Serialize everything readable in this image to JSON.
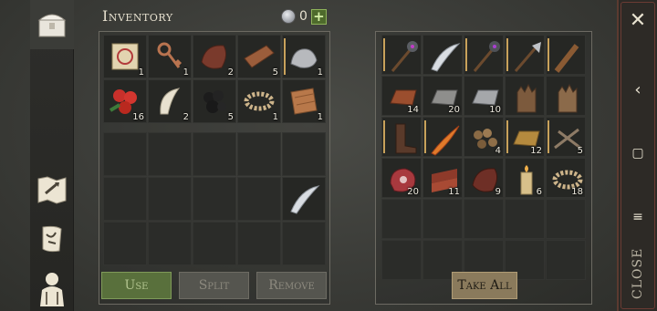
{
  "header": {
    "title": "Inventory",
    "coin_count": "0",
    "add_label": "+"
  },
  "player_items": [
    {
      "icon": "map-scroll-icon",
      "qty": "1"
    },
    {
      "icon": "key-icon",
      "qty": "1"
    },
    {
      "icon": "leather-icon",
      "qty": "2"
    },
    {
      "icon": "cloth-roll-icon",
      "qty": "5"
    },
    {
      "icon": "iron-ore-icon",
      "qty": "1"
    },
    {
      "icon": "berries-icon",
      "qty": "16"
    },
    {
      "icon": "fang-icon",
      "qty": "2"
    },
    {
      "icon": "coal-icon",
      "qty": "5"
    },
    {
      "icon": "rope-icon",
      "qty": "1"
    },
    {
      "icon": "fabric-icon",
      "qty": "1"
    }
  ],
  "storage_items": [
    {
      "icon": "mace-icon",
      "qty": ""
    },
    {
      "icon": "scimitar-icon",
      "qty": ""
    },
    {
      "icon": "spiked-mace-icon",
      "qty": ""
    },
    {
      "icon": "axe-spear-icon",
      "qty": ""
    },
    {
      "icon": "spiked-club-icon",
      "qty": ""
    },
    {
      "icon": "copper-ingot-icon",
      "qty": "14"
    },
    {
      "icon": "stone-block-icon",
      "qty": "20"
    },
    {
      "icon": "iron-ingot-icon",
      "qty": "10"
    },
    {
      "icon": "leather-gloves-icon",
      "qty": ""
    },
    {
      "icon": "gloves-icon",
      "qty": ""
    },
    {
      "icon": "boots-icon",
      "qty": ""
    },
    {
      "icon": "flame-sword-icon",
      "qty": ""
    },
    {
      "icon": "nuggets-icon",
      "qty": "4"
    },
    {
      "icon": "gold-ingot-icon",
      "qty": "12"
    },
    {
      "icon": "nails-icon",
      "qty": "5"
    },
    {
      "icon": "raw-meat-icon",
      "qty": "20"
    },
    {
      "icon": "bacon-icon",
      "qty": "11"
    },
    {
      "icon": "leather-hide-icon",
      "qty": "9"
    },
    {
      "icon": "candle-icon",
      "qty": "6"
    },
    {
      "icon": "rope-icon",
      "qty": "18"
    }
  ],
  "buttons": {
    "use": "Use",
    "split": "Split",
    "remove": "Remove",
    "take_all": "Take All"
  },
  "system": {
    "close": "CLOSE"
  },
  "colors": {
    "accent_green": "#59703c",
    "gold_button": "#8a7a5c",
    "selection": "#c9a25b"
  }
}
